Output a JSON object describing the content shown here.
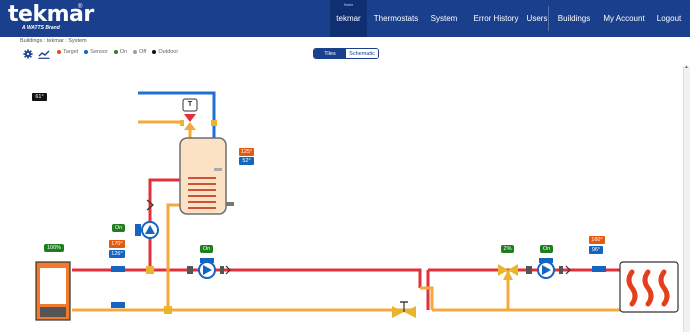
{
  "header": {
    "logo_text": "tekmar",
    "logo_reg": "®",
    "logo_sub": "A WATTS Brand",
    "nav": [
      {
        "label": "tekmar",
        "over": "Home"
      },
      {
        "label": "Thermostats"
      },
      {
        "label": "System"
      },
      {
        "label": "Error History"
      },
      {
        "label": "Users"
      },
      {
        "label": "Buildings"
      },
      {
        "label": "My Account"
      },
      {
        "label": "Logout"
      }
    ]
  },
  "breadcrumb": "Buildings : tekmar : System",
  "legend": [
    {
      "label": "Target",
      "color": "#e64a19"
    },
    {
      "label": "Sensor",
      "color": "#1565c0"
    },
    {
      "label": "On",
      "color": "#2e7d32"
    },
    {
      "label": "Off",
      "color": "#9e9e9e"
    },
    {
      "label": "Outdoor",
      "color": "#111111"
    }
  ],
  "view_toggle": {
    "tiles": "Tiles",
    "schematic": "Schematic",
    "selected": "schematic"
  },
  "schematic": {
    "outdoor_temp": "61°",
    "tank_target": "125°",
    "tank_sensor": "52°",
    "dhw_pump_status": "On",
    "boiler_modulation": "100%",
    "supply_target": "170°",
    "supply_sensor": "126°",
    "boiler_pump_status": "On",
    "mixing_valve": "2%",
    "system_pump_status": "On",
    "system_target": "160°",
    "system_sensor": "96°",
    "thermostat_label": "T"
  },
  "colors": {
    "header_bg": "#1a3f8c",
    "supply_pipe": "#e0303b",
    "return_pipe": "#f4a93c",
    "cold_pipe": "#1f6fd6",
    "pump_blue": "#1565c0",
    "boiler_orange": "#f27a2e"
  }
}
